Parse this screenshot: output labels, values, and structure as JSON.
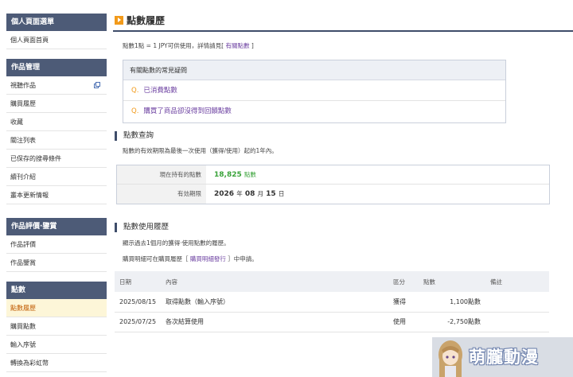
{
  "sidebar": {
    "groups": [
      {
        "header": "個人頁面選單",
        "items": [
          "個人頁面首頁"
        ]
      },
      {
        "header": "作品管理",
        "items": [
          "視聽作品",
          "購買履歷",
          "收藏",
          "關注列表",
          "已保存的搜尋條件",
          "續刊介紹",
          "叢本更新情報"
        ]
      },
      {
        "header": "作品評價·鑒賞",
        "items": [
          "作品評價",
          "作品鑒賞"
        ]
      },
      {
        "header": "點數",
        "items": [
          "點數履歷",
          "購買點數",
          "輸入序號",
          "轉換為彩虹幣"
        ]
      }
    ]
  },
  "main": {
    "title": "點數履歷",
    "intro_prefix": "點數1點 = 1 JPY可供使用，詳情請見[",
    "intro_link": "有關點數",
    "intro_suffix": "]",
    "faq": {
      "header": "有關點數的常見疑問",
      "q_mark": "Q.",
      "items": [
        "已消費點數",
        "購買了商品卻沒得到回饋點數"
      ]
    },
    "balance_section": {
      "title": "點數查詢",
      "desc": "點數的有效期限為最後一次使用（獲得/使用）起的1年內。",
      "rows": {
        "current_label": "現在持有的點數",
        "current_value": "18,825",
        "current_unit": "點數",
        "expiry_label": "有効期限",
        "expiry_year": "2026",
        "year_unit": "年",
        "expiry_month": "08",
        "month_unit": "月",
        "expiry_day": "15",
        "day_unit": "日"
      }
    },
    "history_section": {
      "title": "點數使用履歷",
      "desc1": "顯示過去1個月的獲得·使用點數的履歷。",
      "desc2_prefix": "購買明細可在購買履歷［",
      "desc2_link": "購買明細發行",
      "desc2_suffix": "］中申請。",
      "columns": [
        "日期",
        "內容",
        "區分",
        "點數",
        "備註"
      ],
      "rows": [
        {
          "date": "2025/08/15",
          "content": "取得點數（輸入序號）",
          "type": "獲得",
          "points": "1,100點數",
          "note": ""
        },
        {
          "date": "2025/07/25",
          "content": "各次結算使用",
          "type": "使用",
          "points": "-2,750點數",
          "note": ""
        }
      ]
    }
  },
  "watermark": {
    "text": "萌朧動漫"
  },
  "colors": {
    "nav_header": "#4d5b77",
    "accent_orange": "#f29a1a",
    "link_purple": "#6b3fa0",
    "points_green": "#3aa33a",
    "active_bg": "#fdf6d8"
  }
}
